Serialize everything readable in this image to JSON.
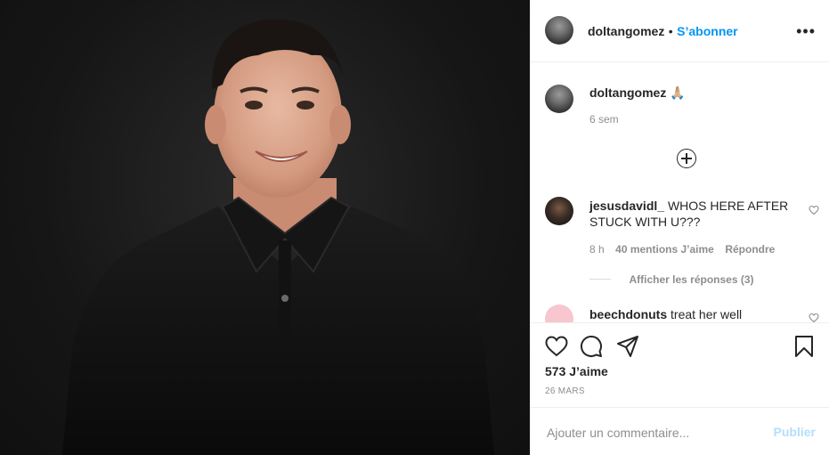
{
  "post": {
    "author": "doltangomez",
    "follow_label": "S’abonner",
    "separator": "•",
    "more_label": "•••"
  },
  "caption": {
    "username": "doltangomez",
    "text": "🙏🏼",
    "time": "6 sem"
  },
  "comments": [
    {
      "username": "jesusdavidl_",
      "text": "WHOS HERE AFTER STUCK WITH U???",
      "time": "8 h",
      "likes": "40 mentions J’aime",
      "reply_label": "Répondre",
      "view_replies": "Afficher les réponses (3)"
    },
    {
      "username": "beechdonuts",
      "text": "treat her well"
    }
  ],
  "stats": {
    "likes": "573 J’aime",
    "date": "26 MARS"
  },
  "comment_box": {
    "placeholder": "Ajouter un commentaire...",
    "publish_label": "Publier"
  },
  "icons": {
    "like": "heart-icon",
    "comment": "comment-icon",
    "share": "share-icon",
    "save": "bookmark-icon",
    "more": "more-options-icon",
    "load_more": "plus-circle-icon"
  },
  "colors": {
    "link_blue": "#0095f6",
    "publish_disabled": "#b2dffc",
    "muted": "#8e8e8e",
    "text": "#262626"
  }
}
